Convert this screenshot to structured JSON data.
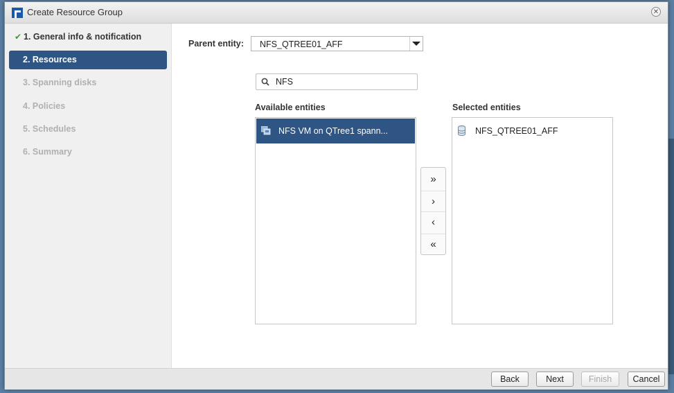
{
  "dialog": {
    "title": "Create Resource Group",
    "close_glyph": "✕"
  },
  "steps": [
    {
      "label": "1. General info & notification",
      "state": "done"
    },
    {
      "label": "2. Resources",
      "state": "active"
    },
    {
      "label": "3. Spanning disks",
      "state": "pending"
    },
    {
      "label": "4. Policies",
      "state": "pending"
    },
    {
      "label": "5. Schedules",
      "state": "pending"
    },
    {
      "label": "6. Summary",
      "state": "pending"
    }
  ],
  "check_glyph": "✔",
  "parent": {
    "label": "Parent entity:",
    "value": "NFS_QTREE01_AFF"
  },
  "search": {
    "value": "NFS"
  },
  "available": {
    "title": "Available entities",
    "items": [
      "NFS VM on QTree1 spann..."
    ]
  },
  "selected": {
    "title": "Selected entities",
    "items": [
      "NFS_QTREE01_AFF"
    ]
  },
  "transfer": {
    "move_all_right": "»",
    "move_right": "›",
    "move_left": "‹",
    "move_all_left": "«"
  },
  "footer": {
    "back": "Back",
    "next": "Next",
    "finish": "Finish",
    "cancel": "Cancel"
  },
  "colors": {
    "accent": "#2e5584",
    "check": "#3a9a3a"
  },
  "icons": {
    "vm": "vm-icon",
    "database": "database-icon",
    "search": "search-icon"
  }
}
